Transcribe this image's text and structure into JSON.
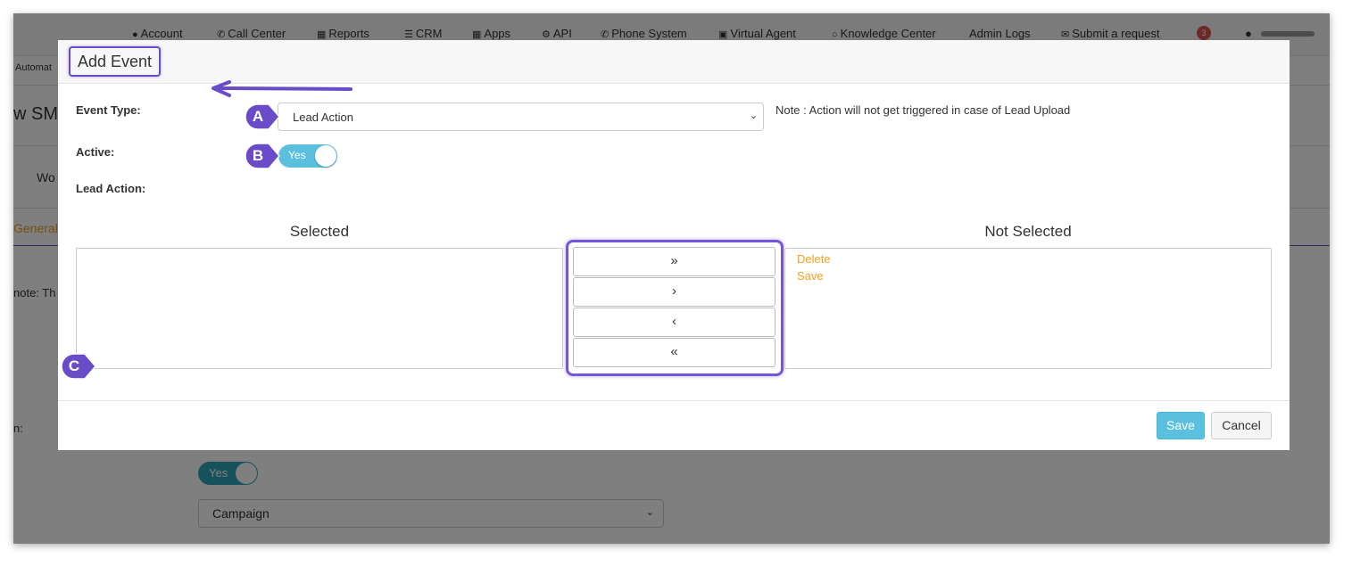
{
  "topnav": {
    "items": [
      {
        "label": "Account",
        "icon": "user-icon"
      },
      {
        "label": "Call Center",
        "icon": "phone-icon"
      },
      {
        "label": "Reports",
        "icon": "bar-chart-icon"
      },
      {
        "label": "CRM",
        "icon": "list-icon"
      },
      {
        "label": "Apps",
        "icon": "grid-icon"
      },
      {
        "label": "API",
        "icon": "gear-icon"
      },
      {
        "label": "Phone System",
        "icon": "phone-icon"
      },
      {
        "label": "Virtual Agent",
        "icon": "monitor-icon"
      },
      {
        "label": "Knowledge Center",
        "icon": "lightbulb-icon"
      },
      {
        "label": "Admin Logs",
        "icon": ""
      },
      {
        "label": "Submit a request",
        "icon": "ticket-icon"
      }
    ],
    "notification_count": "3"
  },
  "background": {
    "breadcrumb": "Automat",
    "page_title": "w SMS",
    "tab_partial": "Wo",
    "general_tab": "General",
    "note_partial": "note: Th",
    "field_label_partial": "n:",
    "toggle_label": "Yes",
    "select_value": "Campaign"
  },
  "modal": {
    "title": "Add Event",
    "event_type_label": "Event Type:",
    "event_type_value": "Lead Action",
    "note": "Note : Action will not get triggered in case of Lead Upload",
    "active_label": "Active:",
    "active_value": "Yes",
    "lead_action_label": "Lead Action:",
    "selected_title": "Selected",
    "not_selected_title": "Not Selected",
    "selected_items": [],
    "not_selected_items": [
      "Delete",
      "Save"
    ],
    "move_buttons": [
      "»",
      "›",
      "‹",
      "«"
    ],
    "save_label": "Save",
    "cancel_label": "Cancel"
  },
  "annotations": {
    "markers": [
      "A",
      "B",
      "C"
    ],
    "color": "#6a4bc8"
  }
}
